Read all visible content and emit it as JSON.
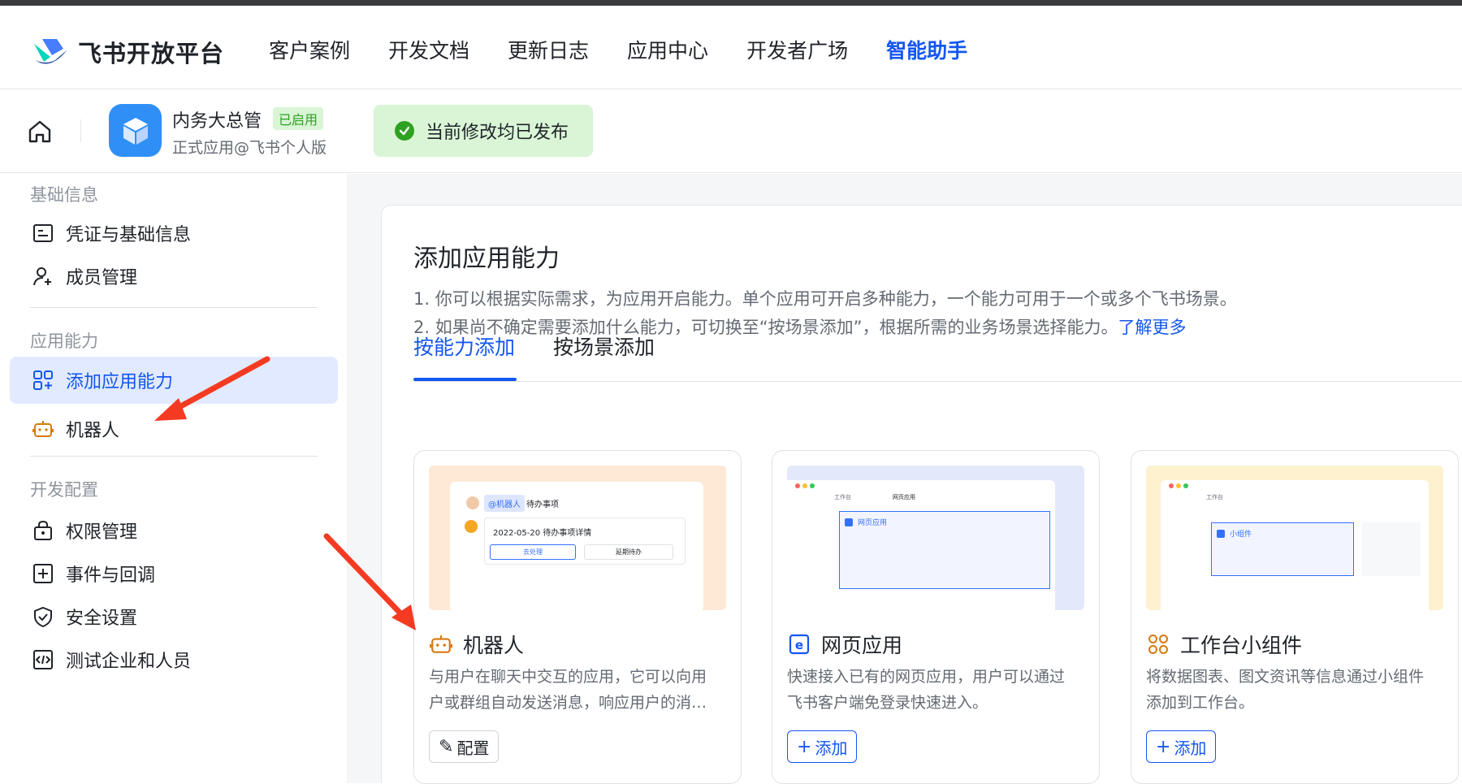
{
  "header": {
    "logo_text": "飞书开放平台",
    "nav": [
      "客户案例",
      "开发文档",
      "更新日志",
      "应用中心",
      "开发者广场",
      "智能助手"
    ],
    "active_nav_index": 5
  },
  "app": {
    "name": "内务大总管",
    "status": "已启用",
    "subtitle": "正式应用@飞书个人版",
    "publish_message": "当前修改均已发布"
  },
  "sidebar": {
    "sections": [
      {
        "title": "基础信息",
        "items": [
          {
            "label": "凭证与基础信息",
            "icon": "credential-icon"
          },
          {
            "label": "成员管理",
            "icon": "member-icon"
          }
        ]
      },
      {
        "title": "应用能力",
        "items": [
          {
            "label": "添加应用能力",
            "icon": "add-capability-icon",
            "active": true
          },
          {
            "label": "机器人",
            "icon": "robot-icon"
          }
        ]
      },
      {
        "title": "开发配置",
        "items": [
          {
            "label": "权限管理",
            "icon": "lock-icon"
          },
          {
            "label": "事件与回调",
            "icon": "event-icon"
          },
          {
            "label": "安全设置",
            "icon": "shield-icon"
          },
          {
            "label": "测试企业和人员",
            "icon": "code-icon"
          }
        ]
      }
    ]
  },
  "main": {
    "title": "添加应用能力",
    "desc1": "1. 你可以根据实际需求，为应用开启能力。单个应用可开启多种能力，一个能力可用于一个或多个飞书场景。",
    "desc2": "2. 如果尚不确定需要添加什么能力，可切换至“按场景添加”，根据所需的业务场景选择能力。",
    "desc2_link": "了解更多",
    "tabs": [
      "按能力添加",
      "按场景添加"
    ],
    "active_tab_index": 0,
    "cards": [
      {
        "title": "机器人",
        "desc": "与用户在聊天中交互的应用，它可以向用户或群组自动发送消息，响应用户的消…",
        "button": "配置",
        "button_icon": "edit-icon",
        "preview": {
          "mention": "@机器人",
          "message": "待办事项",
          "card_date": "2022-05-20 待办事项详情",
          "btn1": "去处理",
          "btn2": "延期待办"
        }
      },
      {
        "title": "网页应用",
        "desc": "快速接入已有的网页应用，用户可以通过飞书客户端免登录快速进入。",
        "button": "添加",
        "button_icon": "plus-icon",
        "preview": {
          "tab1": "工作台",
          "tab2": "网页应用",
          "label": "网页应用"
        }
      },
      {
        "title": "工作台小组件",
        "desc": "将数据图表、图文资讯等信息通过小组件添加到工作台。",
        "button": "添加",
        "button_icon": "plus-icon",
        "preview": {
          "tab1": "工作台",
          "label": "小组件"
        }
      }
    ]
  },
  "colors": {
    "accent": "#1456f0",
    "success": "#2ea121",
    "annotation_arrow": "#f53a22"
  }
}
